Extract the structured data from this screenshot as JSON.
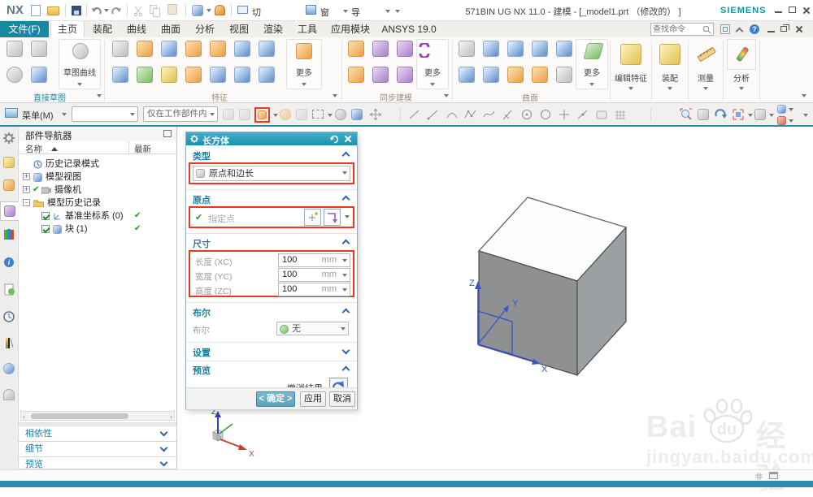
{
  "glyphs": {
    "check": "✔",
    "help": "?"
  },
  "title_bar": {
    "logo": "NX",
    "title": "571BIN UG NX 11.0 - 建模 - [_model1.prt （修改的） ]",
    "brand": "SIEMENS",
    "switch_window": "切换窗口",
    "window": "窗口",
    "export": "导出(E)"
  },
  "tabs": {
    "file": "文件(F)",
    "items": [
      "主页",
      "装配",
      "曲线",
      "曲面",
      "分析",
      "视图",
      "渲染",
      "工具",
      "应用模块",
      "ANSYS 19.0"
    ],
    "search_placeholder": "查找命令"
  },
  "ribbon": {
    "more": "更多",
    "direct_sketch": "直接草图",
    "sketch_curve": "草图曲线",
    "feature": "特征",
    "sync_modeling": "同步建模",
    "surface": "曲面",
    "edit_feature": "编辑特征",
    "assemblies": "装配",
    "measure": "测量",
    "analysis": "分析"
  },
  "toolbar": {
    "menu": "菜单(M)",
    "scope": "仅在工作部件内"
  },
  "navigator": {
    "title": "部件导航器",
    "col_name": "名称",
    "col_status": "最新",
    "rows": [
      {
        "label": "历史记录模式"
      },
      {
        "expand": "+",
        "label": "模型视图"
      },
      {
        "expand": "+",
        "pre": "✔",
        "label": "摄像机"
      },
      {
        "expand": "-",
        "label": "模型历史记录"
      },
      {
        "label": "基准坐标系 (0)",
        "status": "✔"
      },
      {
        "label": "块 (1)",
        "status": "✔"
      }
    ],
    "sections": [
      "相依性",
      "细节",
      "预览"
    ]
  },
  "dialog": {
    "title": "长方体",
    "type_section": "类型",
    "type_value": "原点和边长",
    "origin_section": "原点",
    "point_label": "指定点",
    "dims_section": "尺寸",
    "dims": [
      {
        "label": "长度 (XC)",
        "value": "100",
        "unit": "mm"
      },
      {
        "label": "宽度 (YC)",
        "value": "100",
        "unit": "mm"
      },
      {
        "label": "高度 (ZC)",
        "value": "100",
        "unit": "mm"
      }
    ],
    "bool_section": "布尔",
    "bool_label": "布尔",
    "bool_value": "无",
    "settings_section": "设置",
    "preview_section": "预览",
    "undo_label": "撤消结果",
    "ok": "< 确定 >",
    "apply": "应用",
    "cancel": "取消"
  },
  "viewport": {
    "axes": {
      "x": "X",
      "y": "Y",
      "z": "Z"
    },
    "triad": {
      "x": "X",
      "z": "Z"
    }
  },
  "watermark": {
    "part1": "Bai",
    "part2": "du",
    "part3": "经验",
    "url": "jingyan.baidu.com"
  }
}
